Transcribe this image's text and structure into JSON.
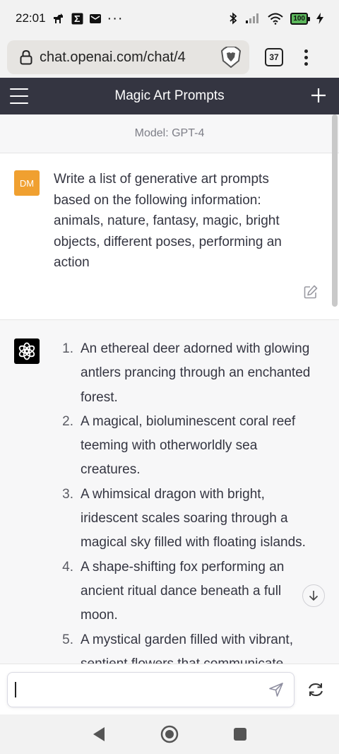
{
  "status_bar": {
    "time": "22:01",
    "dots": "···",
    "battery": "100",
    "icons": [
      "dog-icon",
      "sigma-icon",
      "mail-icon",
      "bluetooth-icon",
      "signal-icon",
      "wifi-icon",
      "battery-icon",
      "charging-icon"
    ]
  },
  "browser": {
    "url": "chat.openai.com/chat/4",
    "tab_count": "37"
  },
  "app_header": {
    "title": "Magic Art Prompts"
  },
  "model_label": "Model: GPT-4",
  "user_message": {
    "avatar_initials": "DM",
    "avatar_color": "#f0a030",
    "text": "Write a list of generative art prompts based on the following information: animals, nature, fantasy, magic, bright objects, different poses, performing an action"
  },
  "assistant_message": {
    "items": [
      {
        "num": "1.",
        "text": "An ethereal deer adorned with glowing antlers prancing through an enchanted forest."
      },
      {
        "num": "2.",
        "text": "A magical, bioluminescent coral reef teeming with otherworldly sea creatures."
      },
      {
        "num": "3.",
        "text": "A whimsical dragon with bright, iridescent scales soaring through a magical sky filled with floating islands."
      },
      {
        "num": "4.",
        "text": "A shape-shifting fox performing an ancient ritual dance beneath a full moon."
      },
      {
        "num": "5.",
        "text": "A mystical garden filled with vibrant, sentient flowers that communicate"
      }
    ]
  },
  "input": {
    "placeholder": ""
  },
  "colors": {
    "header_bg": "#343541",
    "assistant_bg": "#f7f7f8",
    "text": "#343541"
  }
}
